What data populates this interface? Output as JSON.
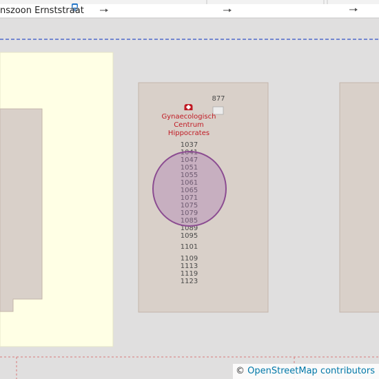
{
  "street": {
    "name": "nszoon Ernststraat"
  },
  "poi": {
    "name_lines": [
      "Gynaecologisch",
      "Centrum",
      "Hippocrates"
    ],
    "icon": "hospital-cross-icon"
  },
  "bus_stop": {
    "icon": "bus-stop-icon"
  },
  "house_numbers": {
    "n877": "877",
    "n1037": "1037",
    "n1041": "1041",
    "n1047": "1047",
    "n1051": "1051",
    "n1055": "1055",
    "n1061": "1061",
    "n1065": "1065",
    "n1071": "1071",
    "n1075": "1075",
    "n1079": "1079",
    "n1085": "1085",
    "n1089": "1089",
    "n1095": "1095",
    "n1101": "1101",
    "n1109": "1109",
    "n1113": "1113",
    "n1119": "1119",
    "n1123": "1123"
  },
  "attribution": {
    "symbol": "©",
    "link_text": "OpenStreetMap contributors"
  },
  "colors": {
    "land": "#e0dfdf",
    "building": "#d9d0c9",
    "building_outline": "#c4b6ab",
    "residential_area": "#ffffe5",
    "road": "#ffffff",
    "poi_text": "#c01a24",
    "boundary": "#3050c8",
    "marker_stroke": "#8b4c91"
  }
}
